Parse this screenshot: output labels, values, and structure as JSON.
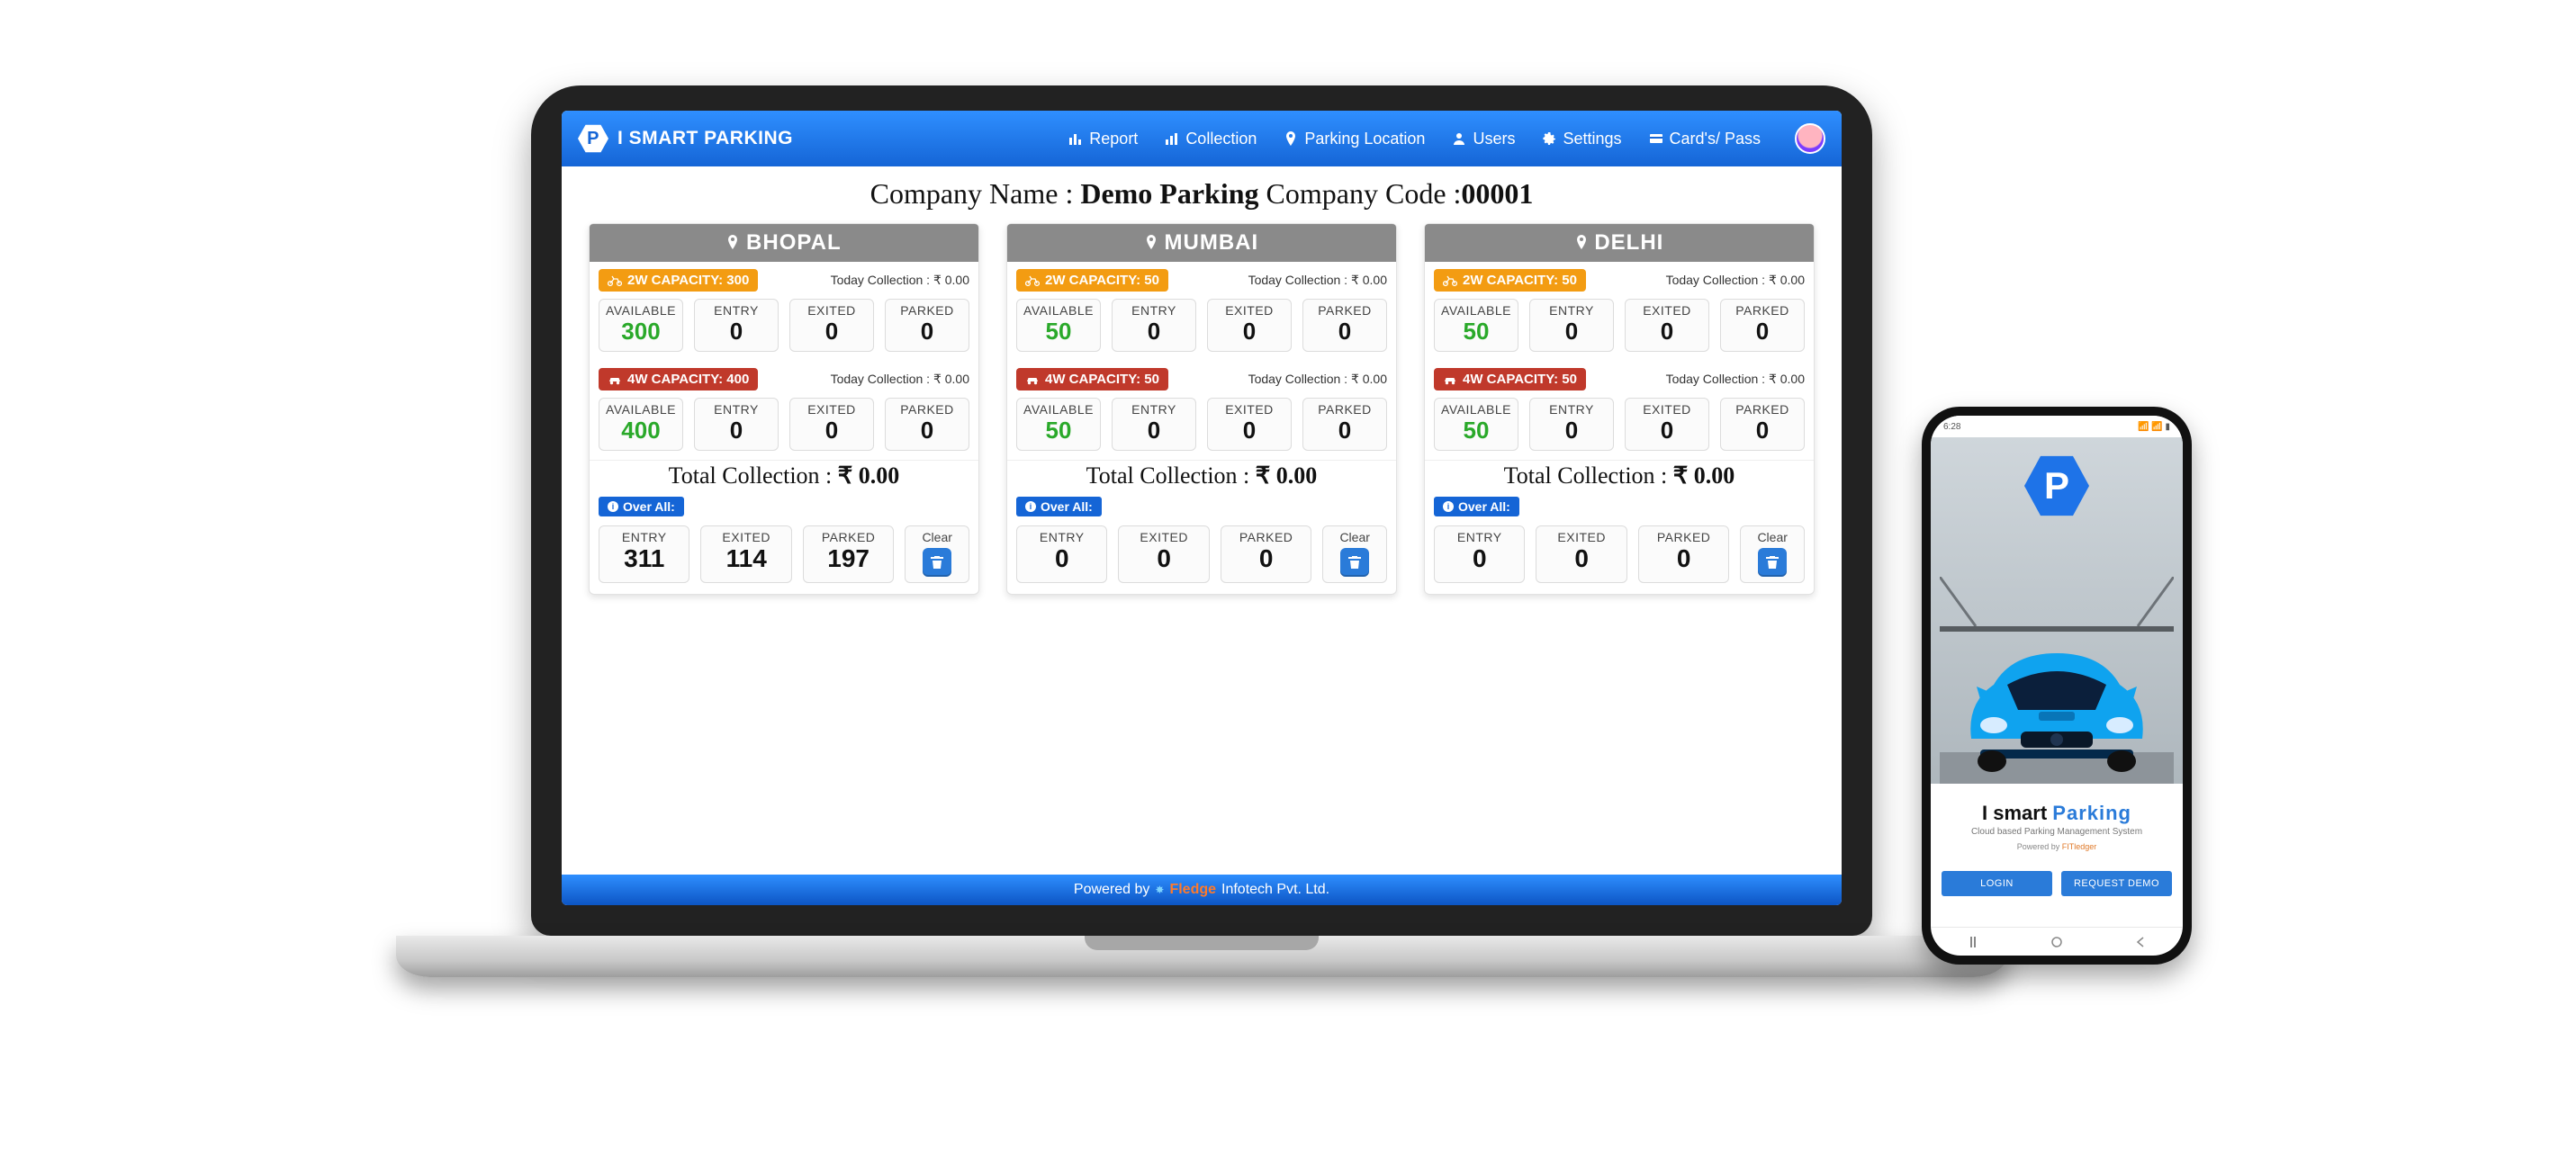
{
  "brand": {
    "name": "I SMART PARKING",
    "logo_letter": "P"
  },
  "nav": {
    "report": "Report",
    "collection": "Collection",
    "parking_location": "Parking Location",
    "users": "Users",
    "settings": "Settings",
    "cards_pass": "Card's/ Pass"
  },
  "company": {
    "name_label": "Company Name : ",
    "name_value": "Demo Parking",
    "code_label": " Company Code :",
    "code_value": "00001"
  },
  "labels": {
    "available": "AVAILABLE",
    "entry": "ENTRY",
    "exited": "EXITED",
    "parked": "PARKED",
    "today_collection_prefix": "Today Collection : ₹ ",
    "total_collection_prefix": "Total Collection : ",
    "overall": "Over All:",
    "clear": "Clear",
    "cap2w_prefix": "2W CAPACITY: ",
    "cap4w_prefix": "4W CAPACITY: "
  },
  "locations": [
    {
      "name": "BHOPAL",
      "two_wheeler": {
        "capacity": "300",
        "today_collection": "0.00",
        "available": "300",
        "entry": "0",
        "exited": "0",
        "parked": "0"
      },
      "four_wheeler": {
        "capacity": "400",
        "today_collection": "0.00",
        "available": "400",
        "entry": "0",
        "exited": "0",
        "parked": "0"
      },
      "total_collection": "₹ 0.00",
      "overall": {
        "entry": "311",
        "exited": "114",
        "parked": "197"
      }
    },
    {
      "name": "MUMBAI",
      "two_wheeler": {
        "capacity": "50",
        "today_collection": "0.00",
        "available": "50",
        "entry": "0",
        "exited": "0",
        "parked": "0"
      },
      "four_wheeler": {
        "capacity": "50",
        "today_collection": "0.00",
        "available": "50",
        "entry": "0",
        "exited": "0",
        "parked": "0"
      },
      "total_collection": "₹ 0.00",
      "overall": {
        "entry": "0",
        "exited": "0",
        "parked": "0"
      }
    },
    {
      "name": "DELHI",
      "two_wheeler": {
        "capacity": "50",
        "today_collection": "0.00",
        "available": "50",
        "entry": "0",
        "exited": "0",
        "parked": "0"
      },
      "four_wheeler": {
        "capacity": "50",
        "today_collection": "0.00",
        "available": "50",
        "entry": "0",
        "exited": "0",
        "parked": "0"
      },
      "total_collection": "₹ 0.00",
      "overall": {
        "entry": "0",
        "exited": "0",
        "parked": "0"
      }
    }
  ],
  "footer": {
    "powered_by": "Powered by ",
    "fledge": "Fledge",
    "suffix": " Infotech Pvt. Ltd."
  },
  "phone": {
    "status_left": "6:28",
    "status_right": "📶 📶 ▮",
    "logo_letter": "P",
    "title_a": "I smart ",
    "title_b": "Parking",
    "subtitle": "Cloud based Parking Management System",
    "powered_prefix": "Powered by ",
    "powered_brand": "FITledger",
    "login": "LOGIN",
    "request_demo": "REQUEST DEMO"
  }
}
